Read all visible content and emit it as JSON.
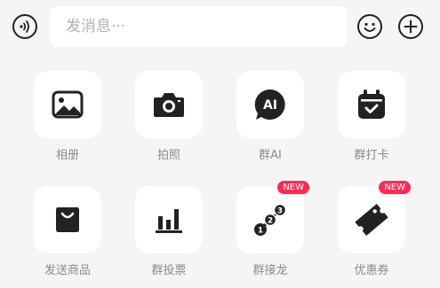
{
  "input_bar": {
    "placeholder": "发消息···",
    "voice_icon": "voice-icon",
    "emoji_icon": "emoji-icon",
    "plus_icon": "plus-icon"
  },
  "tiles": [
    {
      "label": "相册",
      "icon": "image-icon"
    },
    {
      "label": "拍照",
      "icon": "camera-icon"
    },
    {
      "label": "群AI",
      "icon": "ai-chat-icon",
      "icon_text": "AI"
    },
    {
      "label": "群打卡",
      "icon": "calendar-check-icon"
    },
    {
      "label": "发送商品",
      "icon": "shopping-bag-icon"
    },
    {
      "label": "群投票",
      "icon": "bar-chart-icon"
    },
    {
      "label": "群接龙",
      "icon": "solitaire-chain-icon",
      "badge": "NEW"
    },
    {
      "label": "优惠券",
      "icon": "coupon-icon",
      "badge": "NEW"
    }
  ],
  "colors": {
    "background": "#f5f5f5",
    "tile": "#ffffff",
    "icon": "#222222",
    "label": "#8a8a8a",
    "badge": "#ff2a55"
  }
}
